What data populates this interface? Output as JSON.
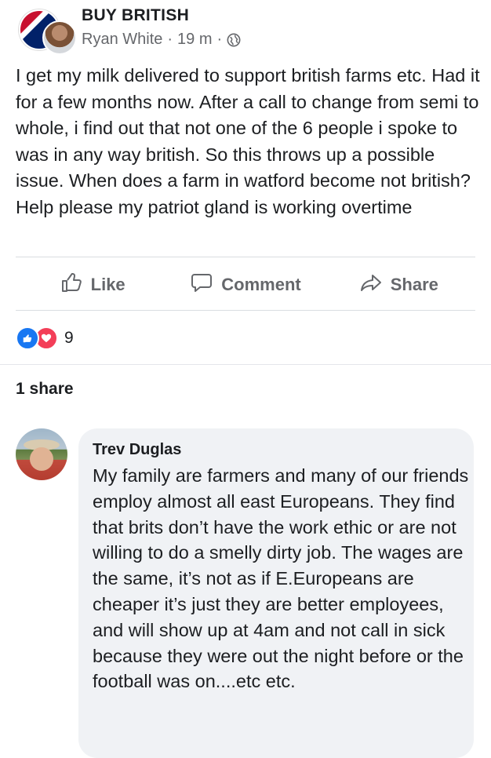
{
  "post": {
    "group_name": "BUY BRITISH",
    "author": "Ryan White",
    "separator": "·",
    "time": "19 m",
    "privacy_icon": "globe-icon",
    "text": "I get my milk delivered to support british farms etc. Had it for a few months now. After a call to change from semi to whole, i find out that not one of the 6 people i spoke to was in any way british. So this throws up a possible issue. When does a farm in watford become not british? Help please my patriot gland is working overtime"
  },
  "actions": {
    "like_label": "Like",
    "comment_label": "Comment",
    "share_label": "Share"
  },
  "reactions": {
    "types": [
      "like",
      "love"
    ],
    "count": "9"
  },
  "shares": {
    "label": "1 share"
  },
  "comment": {
    "author": "Trev Duglas",
    "text": "My family are farmers and many of our friends employ almost all east Europeans. They find that brits don’t have the work ethic or are not willing to do a smelly dirty job. The wages are the same, it’s not as if E.Europeans are cheaper it’s just they are better employees, and will show up at 4am and not call in sick because they were out the night before or the football was on....etc etc."
  },
  "colors": {
    "text_primary": "#1c1e21",
    "text_secondary": "#65676b",
    "like_blue": "#1877f2",
    "love_red": "#f33e58",
    "bubble_bg": "#f0f2f5"
  }
}
